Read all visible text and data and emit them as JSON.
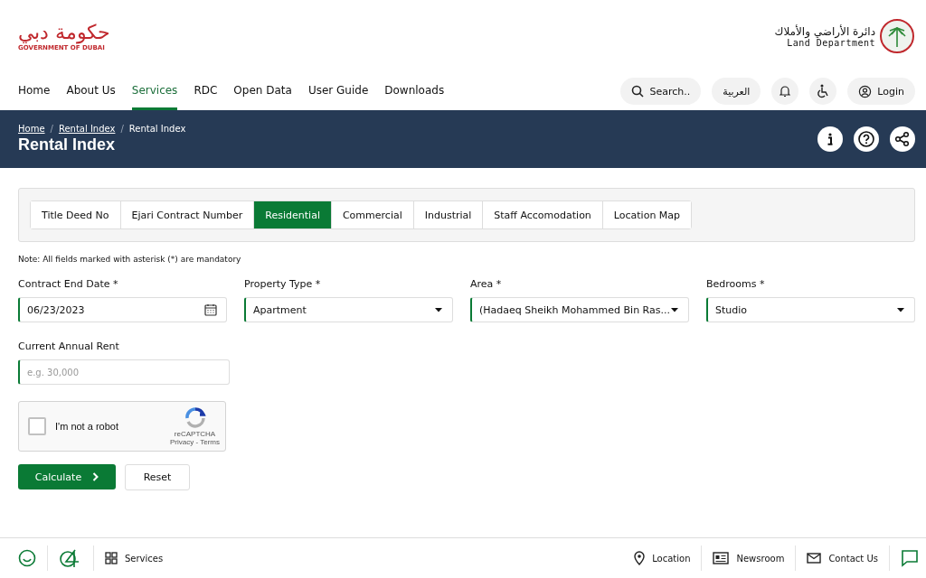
{
  "header": {
    "gov_logo": {
      "arabic": "حكومة دبي",
      "english": "GOVERNMENT OF DUBAI"
    },
    "dept_logo": {
      "arabic": "دائرة الأراضي والأملاك",
      "english": "Land Department"
    }
  },
  "nav": {
    "items": [
      {
        "label": "Home",
        "selected": false
      },
      {
        "label": "About Us",
        "selected": false
      },
      {
        "label": "Services",
        "selected": true
      },
      {
        "label": "RDC",
        "selected": false
      },
      {
        "label": "Open Data",
        "selected": false
      },
      {
        "label": "User Guide",
        "selected": false
      },
      {
        "label": "Downloads",
        "selected": false
      }
    ],
    "search": "Search..",
    "language": "العربية",
    "login": "Login"
  },
  "banner": {
    "separator": "/",
    "breadcrumbs": [
      {
        "label": "Home",
        "link": true
      },
      {
        "label": "Rental Index",
        "link": true
      },
      {
        "label": "Rental Index",
        "link": false
      }
    ],
    "title": "Rental Index"
  },
  "tabs": [
    {
      "label": "Title Deed No",
      "selected": false
    },
    {
      "label": "Ejari Contract Number",
      "selected": false
    },
    {
      "label": "Residential",
      "selected": true
    },
    {
      "label": "Commercial",
      "selected": false
    },
    {
      "label": "Industrial",
      "selected": false
    },
    {
      "label": "Staff Accomodation",
      "selected": false
    },
    {
      "label": "Location Map",
      "selected": false
    }
  ],
  "note": "Note: All fields marked with asterisk (*) are mandatory",
  "fields": [
    {
      "label": "Contract End Date *",
      "kind": "date",
      "value": "06/23/2023"
    },
    {
      "label": "Property Type *",
      "kind": "select",
      "value": "Apartment"
    },
    {
      "label": "Area *",
      "kind": "select",
      "value": "(Hadaeq Sheikh Mohammed Bin Ras..."
    },
    {
      "label": "Bedrooms *",
      "kind": "select",
      "value": "Studio"
    }
  ],
  "rent": {
    "label": "Current Annual Rent",
    "placeholder": "e.g. 30,000"
  },
  "captcha": {
    "label": "I'm not a robot",
    "checked": false,
    "brand": "reCAPTCHA",
    "links": "Privacy - Terms"
  },
  "buttons": {
    "calculate": "Calculate",
    "reset": "Reset"
  },
  "footer": {
    "left": [
      {
        "label": "Services"
      }
    ],
    "right": [
      {
        "label": "Location",
        "kind": "pin"
      },
      {
        "label": "Newsroom",
        "kind": "news"
      },
      {
        "label": "Contact Us",
        "kind": "mail"
      }
    ]
  }
}
